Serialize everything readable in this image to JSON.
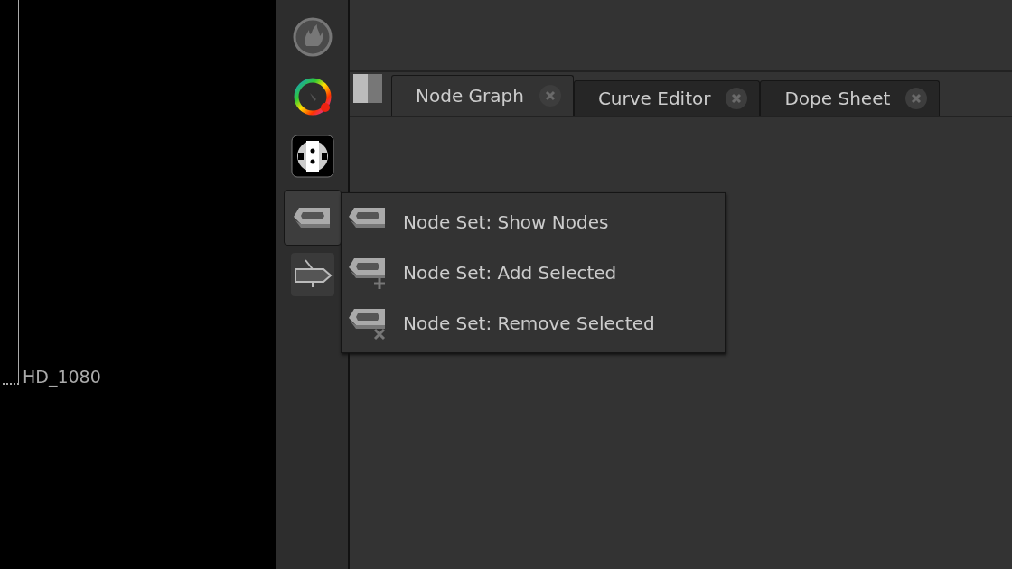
{
  "viewer": {
    "format_label": "HD_1080"
  },
  "toolbar": {
    "buttons": [
      {
        "kind": "flame",
        "selected": false
      },
      {
        "kind": "color-wheel",
        "selected": false
      },
      {
        "kind": "plug",
        "selected": false
      },
      {
        "kind": "node-set",
        "selected": true
      },
      {
        "kind": "arrow-node",
        "selected": false
      }
    ]
  },
  "tabs": [
    {
      "label": "Node Graph",
      "selected": true
    },
    {
      "label": "Curve Editor",
      "selected": false
    },
    {
      "label": "Dope Sheet",
      "selected": false
    }
  ],
  "menu": {
    "items": [
      {
        "label": "Node Set: Show Nodes",
        "kind": "show"
      },
      {
        "label": "Node Set: Add Selected",
        "kind": "add"
      },
      {
        "label": "Node Set: Remove Selected",
        "kind": "remove"
      }
    ]
  }
}
